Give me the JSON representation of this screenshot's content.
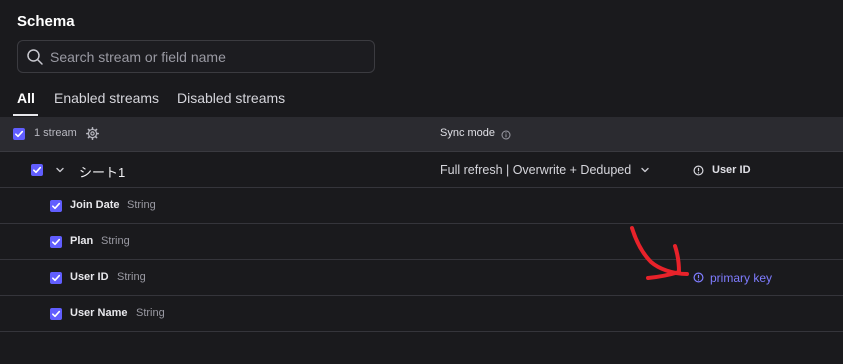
{
  "schema": {
    "title": "Schema",
    "search_placeholder": "Search stream or field name"
  },
  "tabs": [
    {
      "label": "All",
      "active": true
    },
    {
      "label": "Enabled streams",
      "active": false
    },
    {
      "label": "Disabled streams",
      "active": false
    }
  ],
  "header": {
    "stream_count": "1 stream",
    "sync_mode_label": "Sync mode"
  },
  "stream": {
    "name": "シート1",
    "sync_mode": "Full refresh | Overwrite + Deduped",
    "primary_key": "User ID"
  },
  "fields": [
    {
      "name": "Join Date",
      "type": "String",
      "primary_key_label": ""
    },
    {
      "name": "Plan",
      "type": "String",
      "primary_key_label": ""
    },
    {
      "name": "User ID",
      "type": "String",
      "primary_key_label": "primary key"
    },
    {
      "name": "User Name",
      "type": "String",
      "primary_key_label": ""
    }
  ],
  "colors": {
    "accent": "#615eff",
    "link": "#7f7cff",
    "annotation_arrow": "#e8222a",
    "background": "#1a1a1d",
    "header_background": "#2b2b30"
  },
  "icons": {
    "search": "search-icon",
    "settings": "gear-icon",
    "info": "info-icon",
    "expand": "chevron-down-icon",
    "sync_dropdown": "chevron-down-icon",
    "primary_key": "key-info-icon"
  }
}
